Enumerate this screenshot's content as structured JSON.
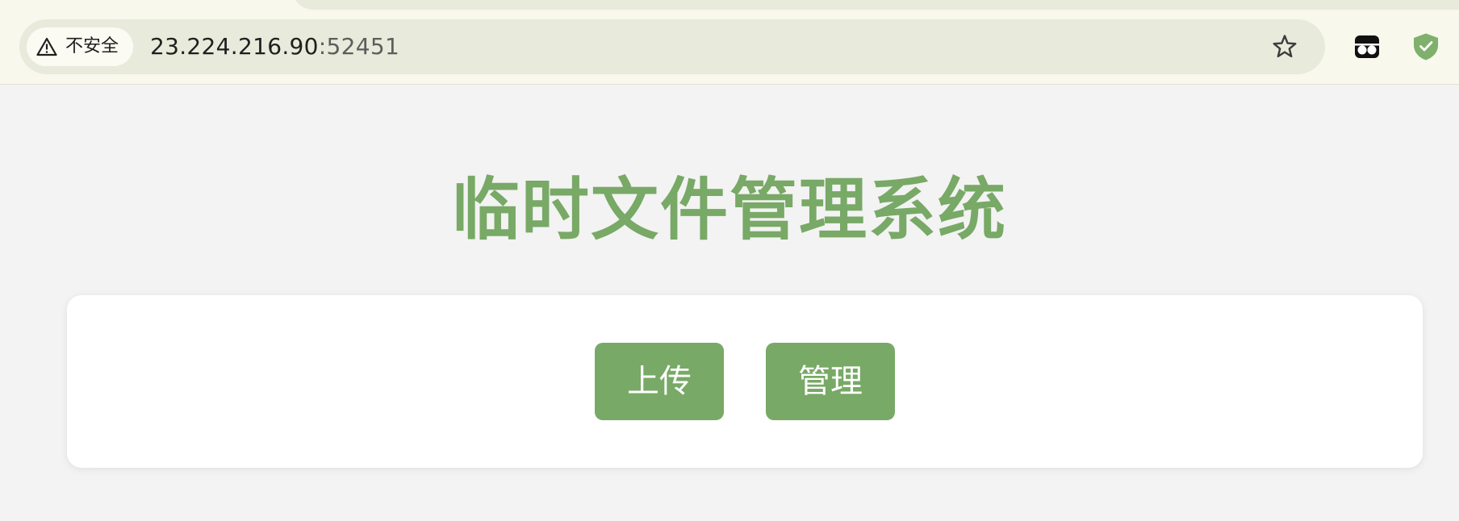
{
  "browser": {
    "security_label": "不安全",
    "url_host": "23.224.216.90",
    "url_port": ":52451",
    "icons": {
      "security": "warning-triangle-icon",
      "bookmark": "star-icon",
      "extension_1": "extension-glasses-icon",
      "extension_2": "extension-shield-check-icon"
    }
  },
  "page": {
    "title": "临时文件管理系统",
    "buttons": {
      "upload_label": "上传",
      "manage_label": "管理"
    }
  },
  "colors": {
    "accent_green": "#78a966",
    "page_background": "#f3f3f3",
    "card_background": "#ffffff",
    "chrome_background": "#f8f8ec",
    "omnibox_background": "#e8eadb"
  }
}
